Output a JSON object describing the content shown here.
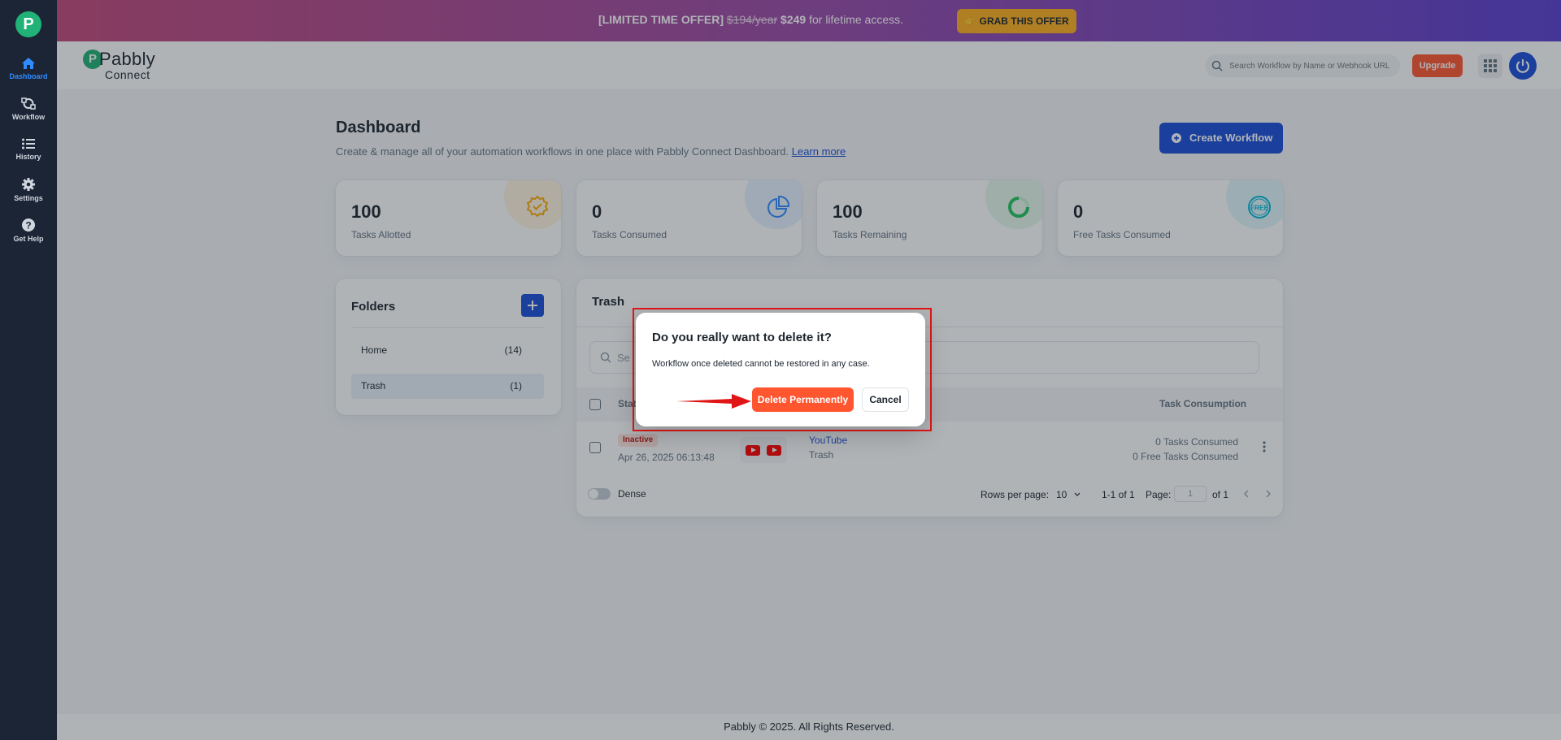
{
  "sidebar": {
    "logo": "P",
    "items": [
      {
        "label": "Dashboard",
        "icon": "home-icon"
      },
      {
        "label": "Workflow",
        "icon": "workflow-icon"
      },
      {
        "label": "History",
        "icon": "history-icon"
      },
      {
        "label": "Settings",
        "icon": "gear-icon"
      },
      {
        "label": "Get Help",
        "icon": "help-icon"
      }
    ]
  },
  "banner": {
    "offer_prefix": "[LIMITED TIME OFFER]",
    "old_price": "$194/year",
    "new_price": "$249",
    "offer_suffix": "for lifetime access.",
    "cta_label": "GRAB THIS OFFER"
  },
  "header": {
    "brand_mark": "P",
    "brand_name": "Pabbly",
    "brand_sub": "Connect",
    "search_placeholder": "Search Workflow by Name or Webhook URL",
    "upgrade_label": "Upgrade"
  },
  "page": {
    "title": "Dashboard",
    "subtitle": "Create & manage all of your automation workflows in one place with Pabbly Connect Dashboard.",
    "learn_more": "Learn more",
    "create_label": "Create Workflow"
  },
  "stats": [
    {
      "value": "100",
      "label": "Tasks Allotted",
      "color": "#ffab00"
    },
    {
      "value": "0",
      "label": "Tasks Consumed",
      "color": "#2f8cff"
    },
    {
      "value": "100",
      "label": "Tasks Remaining",
      "color": "#22c55e"
    },
    {
      "value": "0",
      "label": "Free Tasks Consumed",
      "color": "#00b8d9",
      "badge": "FREE"
    }
  ],
  "folders": {
    "title": "Folders",
    "items": [
      {
        "name": "Home",
        "count": "(14)"
      },
      {
        "name": "Trash",
        "count": "(1)"
      }
    ]
  },
  "trash": {
    "title": "Trash",
    "search_placeholder": "Se",
    "columns": {
      "status": "Stat",
      "tasks": "Task Consumption"
    },
    "row": {
      "status": "Inactive",
      "date": "Apr 26, 2025 06:13:48",
      "name": "YouTube",
      "folder": "Trash",
      "tasks_consumed": "0 Tasks Consumed",
      "free_tasks_consumed": "0 Free Tasks Consumed"
    },
    "dense_label": "Dense",
    "rows_per_page_label": "Rows per page:",
    "rows_per_page": "10",
    "range": "1-1 of 1",
    "page_label": "Page:",
    "page_value": "1",
    "page_of": "of 1"
  },
  "footer": {
    "text": "Pabbly © 2025. All Rights Reserved."
  },
  "dialog": {
    "title": "Do you really want to delete it?",
    "body": "Workflow once deleted cannot be restored in any case.",
    "delete_label": "Delete Permanently",
    "cancel_label": "Cancel"
  },
  "colors": {
    "primary": "#1a4ed8",
    "danger": "#ff5630",
    "brand_green": "#20b276",
    "offer_yellow": "#ffb020",
    "highlight_red": "#e01616"
  }
}
